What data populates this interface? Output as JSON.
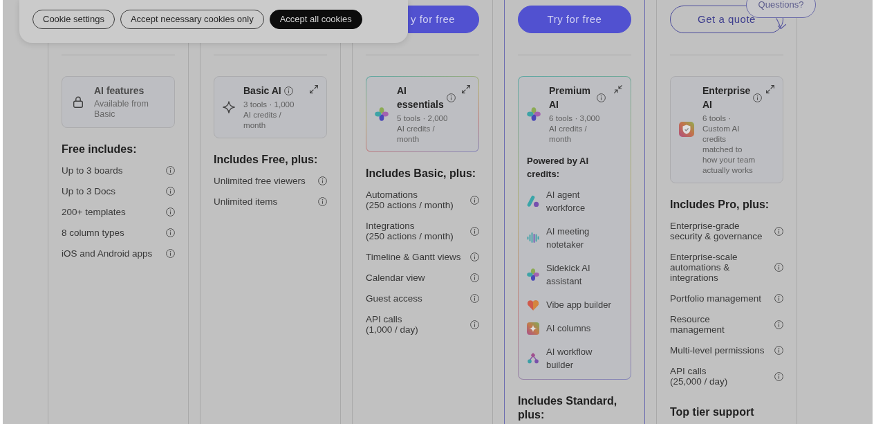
{
  "cookie_banner": {
    "buttons": [
      {
        "label": "Cookie settings",
        "kind": "outline"
      },
      {
        "label": "Accept necessary cookies only",
        "kind": "outline"
      },
      {
        "label": "Accept all cookies",
        "kind": "filled"
      }
    ]
  },
  "help": {
    "label": "Questions?"
  },
  "plans": [
    {
      "highlighted": false,
      "ai_box": {
        "kind": "locked",
        "title": "AI features",
        "subtitle": "Available from Basic"
      },
      "sections": [
        {
          "heading": "Free includes:",
          "features": [
            "Up to 3 boards",
            "Up to 3 Docs",
            "200+ templates",
            "8 column types",
            "iOS and Android apps"
          ]
        }
      ]
    },
    {
      "highlighted": false,
      "ai_box": {
        "kind": "plain",
        "title": "Basic AI",
        "subtitle": "3 tools · 1,000 AI credits / month",
        "expanded": false
      },
      "sections": [
        {
          "heading": "Includes Free, plus:",
          "features": [
            "Unlimited free viewers",
            "Unlimited items"
          ]
        }
      ]
    },
    {
      "highlighted": false,
      "button": {
        "label": "y for free",
        "kind": "filled"
      },
      "ai_box": {
        "kind": "gradient",
        "title": "AI essentials",
        "subtitle": "5 tools · 2,000 AI credits / month",
        "expanded": false
      },
      "sections": [
        {
          "heading": "Includes Basic, plus:",
          "features": [
            "Automations\n(250 actions / month)",
            "Integrations\n(250 actions / month)",
            "Timeline & Gantt views",
            "Calendar view",
            "Guest access",
            "API calls\n(1,000 / day)"
          ]
        }
      ]
    },
    {
      "highlighted": true,
      "button": {
        "label": "Try for free",
        "kind": "filled"
      },
      "ai_box": {
        "kind": "gradient",
        "title": "Premium AI",
        "subtitle": "6 tools · 3,000 AI credits / month",
        "expanded": true,
        "list_heading": "Powered by AI credits:",
        "tools": [
          "AI agent workforce",
          "AI meeting notetaker",
          "Sidekick AI assistant",
          "Vibe app builder",
          "AI columns",
          "AI workflow builder"
        ]
      },
      "sections": [
        {
          "heading": "Includes Standard, plus:"
        }
      ]
    },
    {
      "highlighted": false,
      "button": {
        "label": "Get a quote",
        "kind": "outline"
      },
      "ai_box": {
        "kind": "plain",
        "title": "Enterprise AI",
        "subtitle": "6 tools · Custom AI credits matched to how your team actually works",
        "expanded": false
      },
      "sections": [
        {
          "heading": "Includes Pro, plus:",
          "features": [
            "Enterprise-grade\nsecurity & governance",
            "Enterprise-scale\nautomations &\nintegrations",
            "Portfolio management",
            "Resource\nmanagement",
            "Multi-level permissions",
            "API calls\n(25,000 / day)"
          ]
        },
        {
          "heading": "Top tier support"
        }
      ]
    }
  ]
}
